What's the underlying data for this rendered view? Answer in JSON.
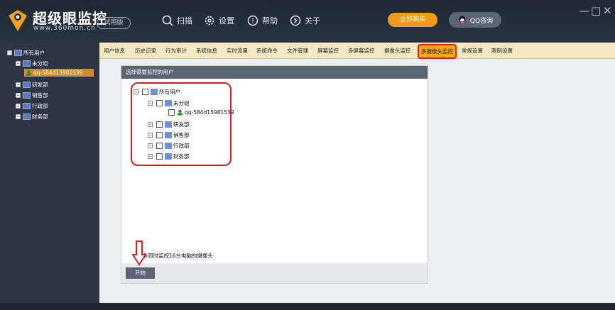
{
  "app": {
    "title": "超级眼监控",
    "url": "www.360mon.cn",
    "badge": "试用版"
  },
  "topnav": [
    {
      "label": "扫描",
      "icon": "search-icon"
    },
    {
      "label": "设置",
      "icon": "gear-icon"
    },
    {
      "label": "帮助",
      "icon": "info-icon"
    },
    {
      "label": "关于",
      "icon": "arrow-right-circle-icon"
    }
  ],
  "buttons": {
    "buy": "立即购买",
    "qq": "QQ咨询",
    "start": "开始"
  },
  "window_controls": [
    "—",
    "□",
    "✕"
  ],
  "sidebar": {
    "root": "所有用户",
    "group_unassigned": "未分组",
    "user": "qq-584d15981539",
    "groups": [
      "研发部",
      "销售部",
      "行政部",
      "财务部"
    ]
  },
  "tabs": [
    "用户信息",
    "历史记录",
    "行为审计",
    "系统信息",
    "实时流量",
    "系统命令",
    "文件管理",
    "屏幕监控",
    "多屏幕监控",
    "摄像头监控",
    "多摄像头监控",
    "常规设置",
    "限制设置"
  ],
  "active_tab": "多摄像头监控",
  "panel": {
    "header": "选择需要监控的用户",
    "root": "所有用户",
    "group_unassigned": "未分组",
    "user": "qq-584d15981539",
    "groups": [
      "研发部",
      "销售部",
      "行政部",
      "财务部"
    ],
    "hint": "最多同时监控16台电脑的摄像头"
  },
  "colors": {
    "accent_orange": "#f39b1a",
    "highlight_red": "#e0202a",
    "header_gray": "#5b6475"
  }
}
